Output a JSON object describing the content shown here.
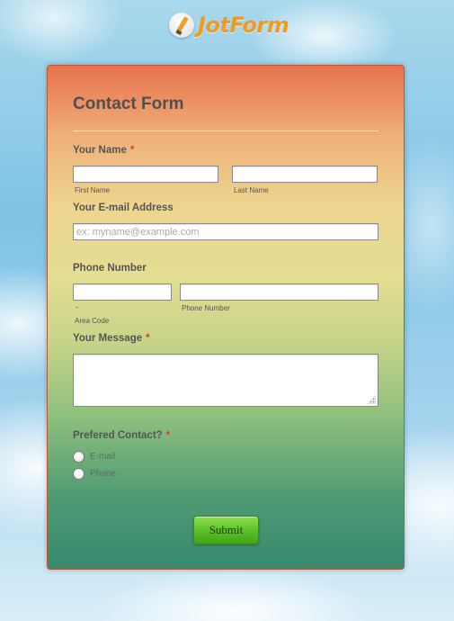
{
  "brand": {
    "logo_text": "JotForm",
    "logo_icon": "jotform-pencil-icon"
  },
  "form": {
    "title": "Contact Form",
    "name": {
      "label": "Your Name",
      "required_mark": "*",
      "first_sublabel": "First Name",
      "last_sublabel": "Last Name",
      "first_value": "",
      "last_value": ""
    },
    "email": {
      "label": "Your E-mail Address",
      "placeholder": "ex: myname@example.com",
      "value": ""
    },
    "phone": {
      "label": "Phone Number",
      "separator": "-",
      "area_sublabel": "Area Code",
      "number_sublabel": "Phone Number",
      "area_value": "",
      "number_value": ""
    },
    "message": {
      "label": "Your Message",
      "required_mark": "*",
      "value": ""
    },
    "contact_pref": {
      "label": "Prefered Contact?",
      "required_mark": "*",
      "options": [
        "E-mail",
        "Phone"
      ],
      "selected": null
    },
    "submit_label": "Submit"
  },
  "colors": {
    "card_top": "#e8724e",
    "card_mid": "#e3de92",
    "card_bottom": "#378a6f",
    "required": "#e03c20",
    "logo": "#f39a1e",
    "submit": "#5fc12a"
  }
}
